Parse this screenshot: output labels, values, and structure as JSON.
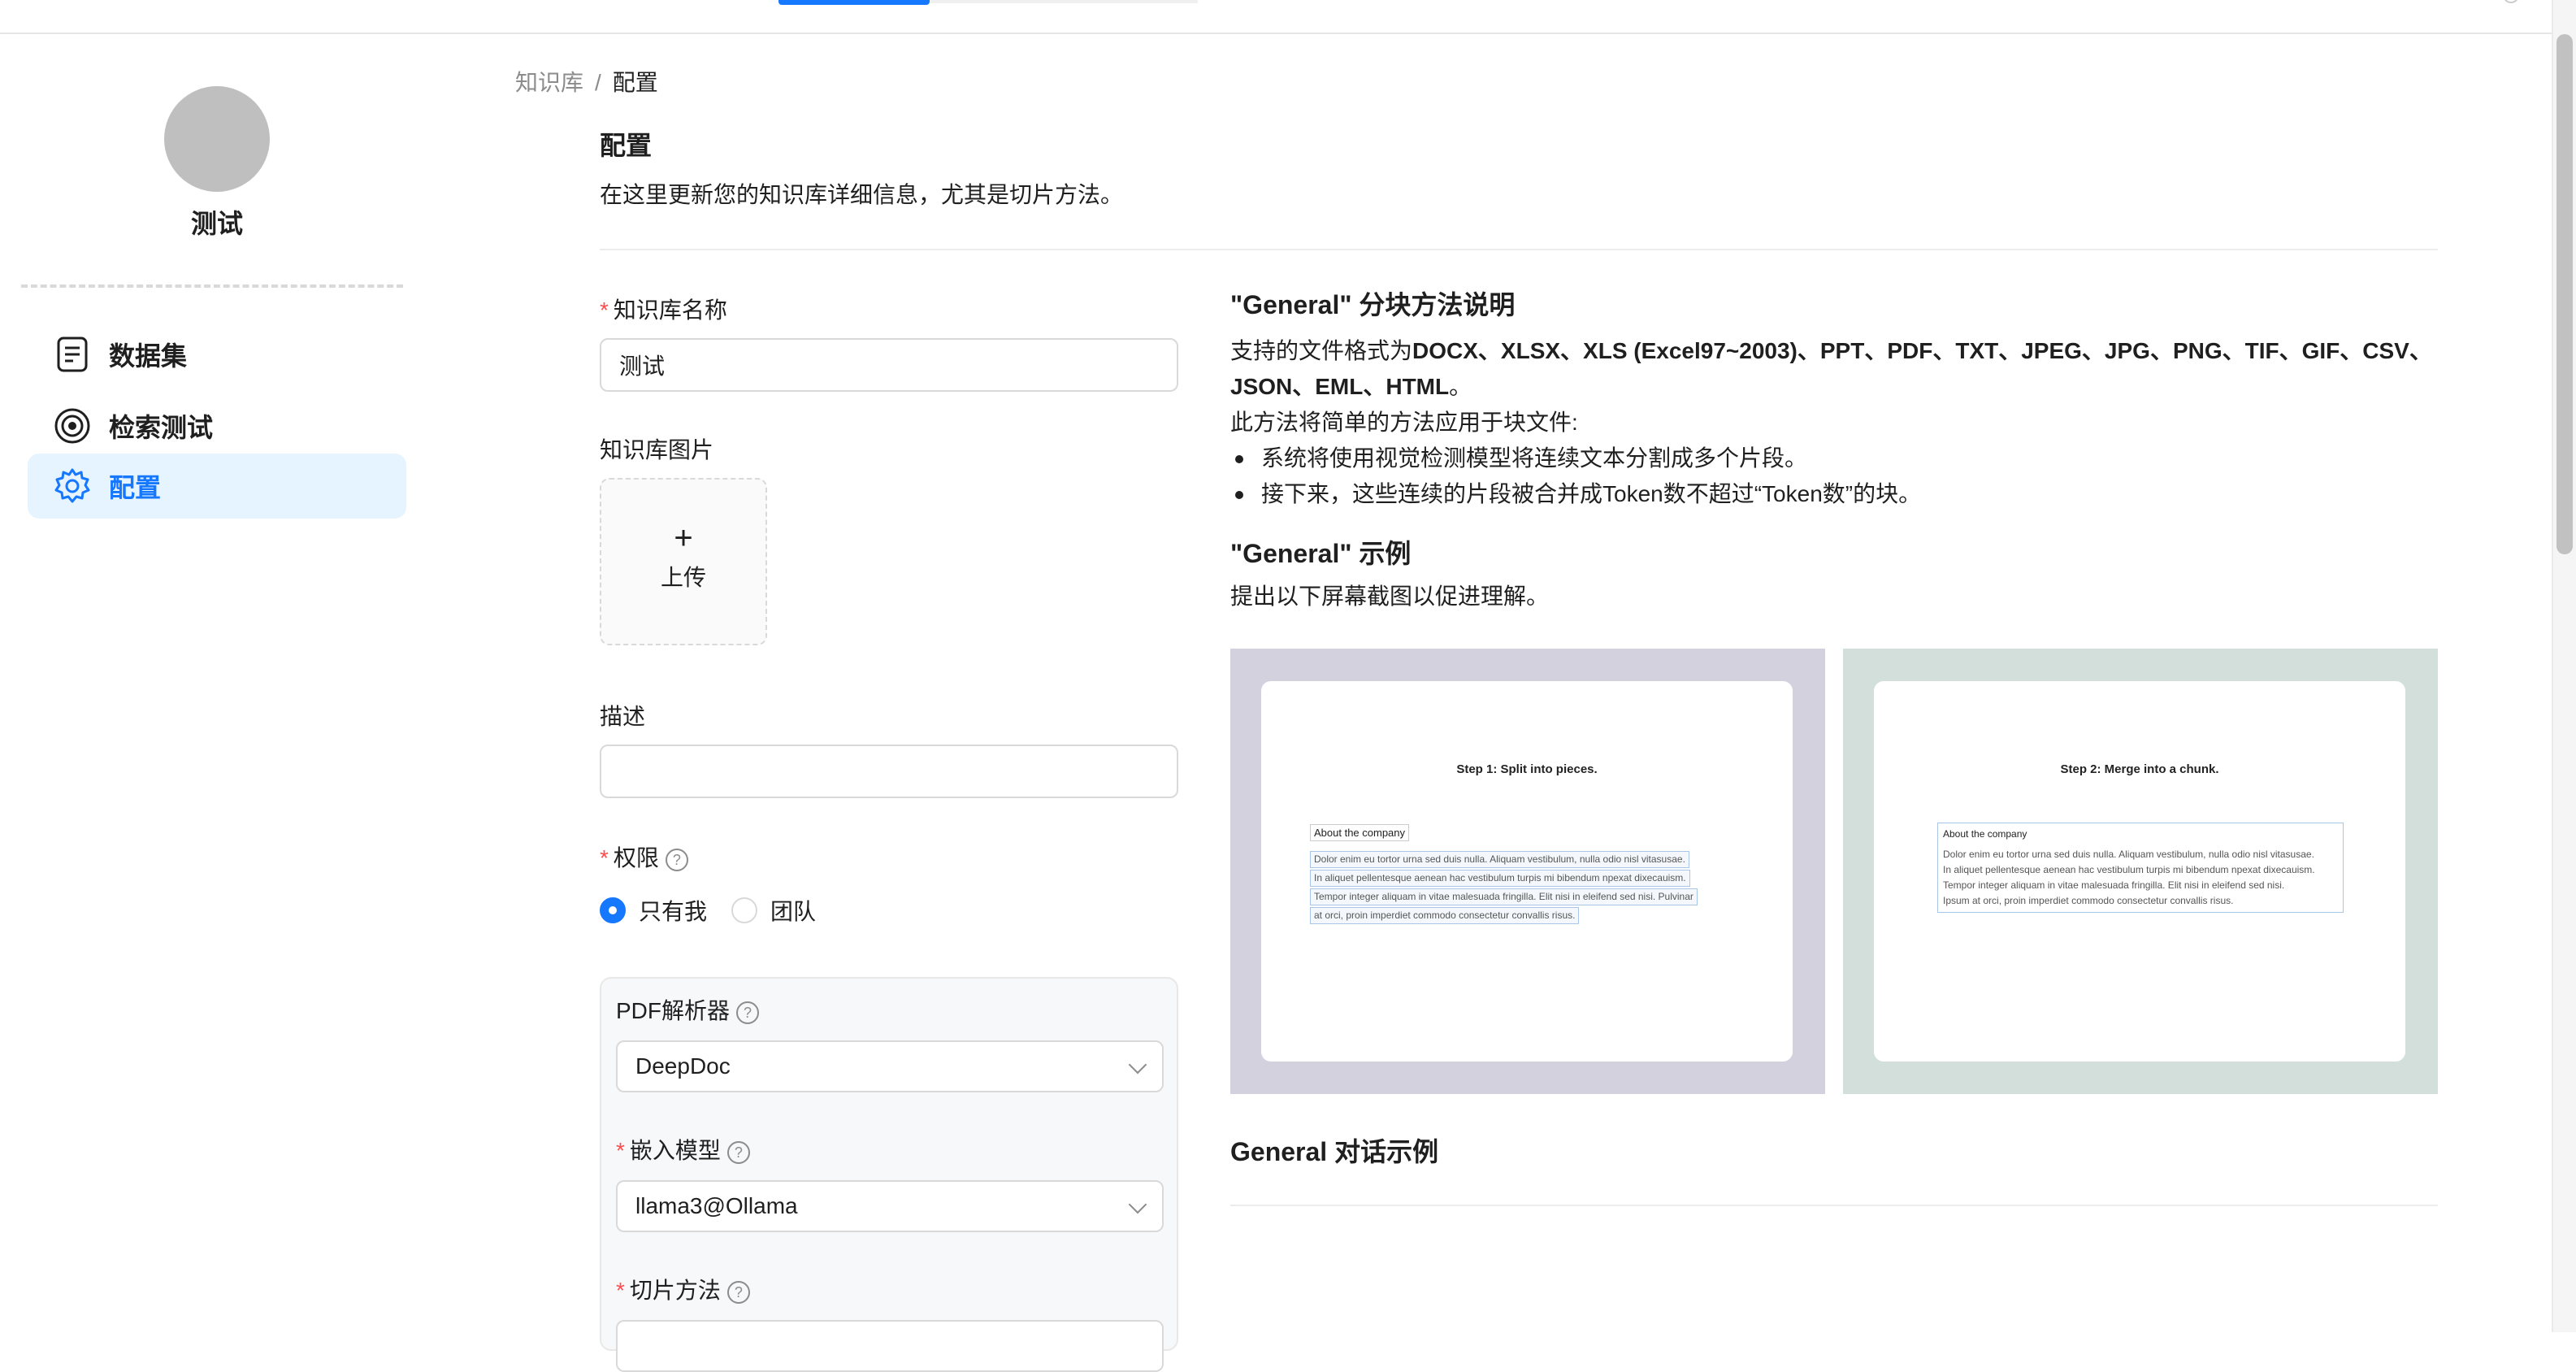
{
  "sidebar": {
    "kb_name": "测试",
    "items": [
      {
        "label": "数据集",
        "icon": "document-icon"
      },
      {
        "label": "检索测试",
        "icon": "target-icon"
      },
      {
        "label": "配置",
        "icon": "gear-icon",
        "active": true
      }
    ]
  },
  "breadcrumb": {
    "root": "知识库",
    "separator": "/",
    "current": "配置"
  },
  "header": {
    "title": "配置",
    "subtitle": "在这里更新您的知识库详细信息，尤其是切片方法。"
  },
  "form": {
    "name_label": "知识库名称",
    "name_value": "测试",
    "image_label": "知识库图片",
    "upload_plus": "+",
    "upload_label": "上传",
    "description_label": "描述",
    "description_value": "",
    "permission_label": "权限",
    "permission_options": [
      "只有我",
      "团队"
    ],
    "permission_selected": "只有我",
    "pdf_parser_label": "PDF解析器",
    "pdf_parser_value": "DeepDoc",
    "embedding_label": "嵌入模型",
    "embedding_value": "llama3@Ollama",
    "chunk_method_label": "切片方法",
    "help_glyph": "?",
    "required_mark": "*"
  },
  "info": {
    "method_title": "\"General\" 分块方法说明",
    "formats_prefix": "支持的文件格式为",
    "formats_bold": "DOCX、XLSX、XLS (Excel97~2003)、PPT、PDF、TXT、JPEG、JPG、PNG、TIF、GIF、CSV、JSON、EML、HTML",
    "formats_suffix": "。",
    "method_intro": "此方法将简单的方法应用于块文件:",
    "bullets": [
      "系统将使用视觉检测模型将连续文本分割成多个片段。",
      "接下来，这些连续的片段被合并成Token数不超过“Token数”的块。"
    ],
    "example_title": "\"General\" 示例",
    "example_sub": "提出以下屏幕截图以促进理解。",
    "dialog_title": "General 对话示例"
  },
  "screenshots": {
    "step1": {
      "title": "Step 1: Split into pieces.",
      "heading": "About the company",
      "lines": [
        "Dolor enim eu tortor urna sed duis nulla. Aliquam vestibulum, nulla odio nisl vitasusae.",
        "In aliquet pellentesque aenean hac vestibulum turpis mi bibendum npexat dixecauism.",
        "Tempor integer aliquam in vitae malesuada fringilla. Elit nisi in eleifend sed nisi. Pulvinar",
        "at orci, proin imperdiet commodo consectetur convallis risus."
      ]
    },
    "step2": {
      "title": "Step 2: Merge into a chunk.",
      "heading": "About the company",
      "lines": [
        "Dolor enim eu tortor urna sed duis nulla. Aliquam vestibulum, nulla odio nisl vitasusae.",
        "In aliquet pellentesque aenean hac vestibulum turpis mi bibendum npexat dixecauism.",
        "Tempor integer aliquam in vitae malesuada fringilla. Elit nisi in eleifend sed nisi.",
        "Ipsum at orci, proin imperdiet commodo consectetur convallis risus."
      ]
    }
  },
  "colors": {
    "accent": "#1677ff",
    "active_bg": "#e6f4ff",
    "required": "#ff4d4f",
    "step1_bg": "#d4d1de",
    "step2_bg": "#d2dfda"
  }
}
